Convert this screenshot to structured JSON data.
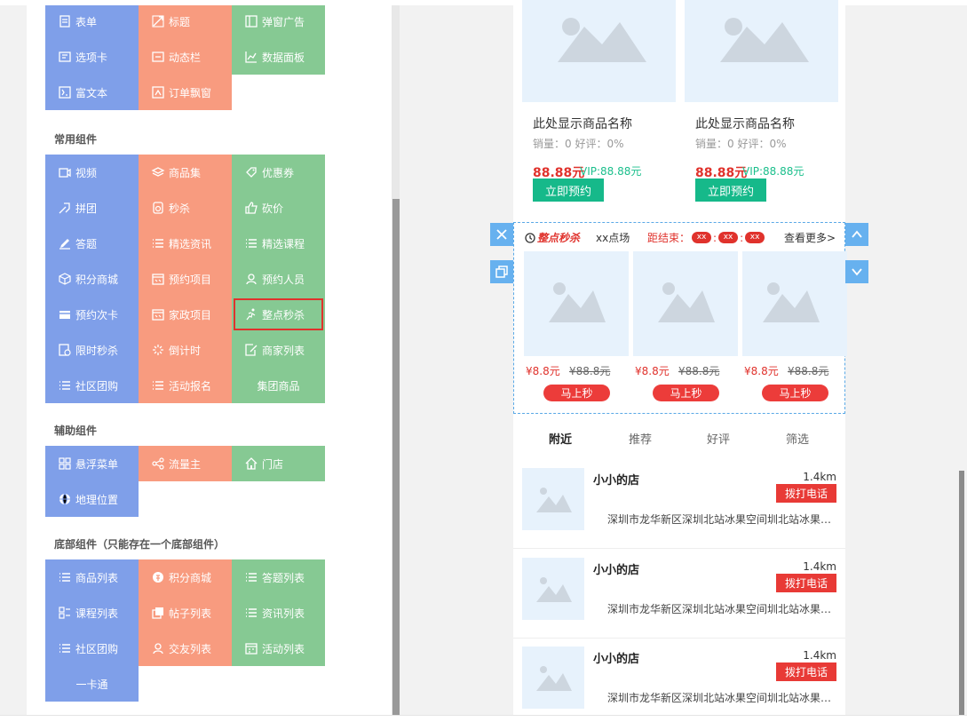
{
  "component_panel": {
    "top_rows": [
      [
        {
          "label": "表单",
          "icon": "form-icon"
        },
        {
          "label": "标题",
          "icon": "title-icon"
        },
        {
          "label": "弹窗广告",
          "icon": "popup-ad-icon"
        }
      ],
      [
        {
          "label": "选项卡",
          "icon": "tab-icon"
        },
        {
          "label": "动态栏",
          "icon": "dynamic-bar-icon"
        },
        {
          "label": "数据面板",
          "icon": "chart-icon"
        }
      ],
      [
        {
          "label": "富文本",
          "icon": "richtext-icon"
        },
        {
          "label": "订单飘窗",
          "icon": "order-float-icon"
        }
      ]
    ],
    "sections": {
      "common": {
        "title": "常用组件",
        "rows": [
          [
            {
              "label": "视频",
              "icon": "video-icon"
            },
            {
              "label": "商品集",
              "icon": "layers-icon"
            },
            {
              "label": "优惠券",
              "icon": "coupon-icon"
            }
          ],
          [
            {
              "label": "拼团",
              "icon": "group-buy-icon"
            },
            {
              "label": "秒杀",
              "icon": "seckill-icon"
            },
            {
              "label": "砍价",
              "icon": "thumb-icon"
            }
          ],
          [
            {
              "label": "答题",
              "icon": "pencil-icon"
            },
            {
              "label": "精选资讯",
              "icon": "list-icon"
            },
            {
              "label": "精选课程",
              "icon": "list-icon"
            }
          ],
          [
            {
              "label": "积分商城",
              "icon": "cube-icon"
            },
            {
              "label": "预约项目",
              "icon": "appointment-icon"
            },
            {
              "label": "预约人员",
              "icon": "person-icon"
            }
          ],
          [
            {
              "label": "预约次卡",
              "icon": "card-icon"
            },
            {
              "label": "家政项目",
              "icon": "appointment-icon"
            },
            {
              "label": "整点秒杀",
              "icon": "running-icon"
            }
          ],
          [
            {
              "label": "限时秒杀",
              "icon": "timer-doc-icon"
            },
            {
              "label": "倒计时",
              "icon": "spinner-icon"
            },
            {
              "label": "商家列表",
              "icon": "edit-doc-icon"
            }
          ],
          [
            {
              "label": "社区团购",
              "icon": "list-icon"
            },
            {
              "label": "活动报名",
              "icon": "list-icon"
            },
            {
              "label": "集团商品",
              "icon": ""
            }
          ]
        ]
      },
      "aux": {
        "title": "辅助组件",
        "rows": [
          [
            {
              "label": "悬浮菜单",
              "icon": "grid-icon"
            },
            {
              "label": "流量主",
              "icon": "share-icon"
            },
            {
              "label": "门店",
              "icon": "home-icon"
            }
          ],
          [
            {
              "label": "地理位置",
              "icon": "globe-icon"
            }
          ]
        ]
      },
      "bottom": {
        "title": "底部组件（只能存在一个底部组件）",
        "rows": [
          [
            {
              "label": "商品列表",
              "icon": "list-icon"
            },
            {
              "label": "积分商城",
              "icon": "coin-icon"
            },
            {
              "label": "答题列表",
              "icon": "list-icon"
            }
          ],
          [
            {
              "label": "课程列表",
              "icon": "course-icon"
            },
            {
              "label": "帖子列表",
              "icon": "post-icon"
            },
            {
              "label": "资讯列表",
              "icon": "list-icon"
            }
          ],
          [
            {
              "label": "社区团购",
              "icon": "list-icon"
            },
            {
              "label": "交友列表",
              "icon": "person-icon"
            },
            {
              "label": "活动列表",
              "icon": "calendar-icon"
            }
          ],
          [
            {
              "label": "一卡通",
              "icon": ""
            }
          ]
        ]
      }
    },
    "selected": "整点秒杀"
  },
  "preview": {
    "products": [
      {
        "name": "此处显示商品名称",
        "meta": "销量：0 好评：0%",
        "price": "88.88元",
        "vip": "VIP:88.88元",
        "button": "立即预约"
      },
      {
        "name": "此处显示商品名称",
        "meta": "销量：0 好评：0%",
        "price": "88.88元",
        "vip": "VIP:88.88元",
        "button": "立即预约"
      }
    ],
    "seckill": {
      "title": "整点秒杀",
      "session": "xx点场",
      "countdown_label": "距结束：",
      "pills": [
        "xx",
        "xx",
        "xx"
      ],
      "more": "查看更多>",
      "items": [
        {
          "price": "¥8.8元",
          "original": "¥88.8元",
          "button": "马上秒"
        },
        {
          "price": "¥8.8元",
          "original": "¥88.8元",
          "button": "马上秒"
        },
        {
          "price": "¥8.8元",
          "original": "¥88.8元",
          "button": "马上秒"
        }
      ]
    },
    "tabs": [
      "附近",
      "推荐",
      "好评",
      "筛选"
    ],
    "stores": [
      {
        "name": "小小的店",
        "distance": "1.4km",
        "button": "拨打电话",
        "address": "深圳市龙华新区深圳北站冰果空间圳北站冰果空间"
      },
      {
        "name": "小小的店",
        "distance": "1.4km",
        "button": "拨打电话",
        "address": "深圳市龙华新区深圳北站冰果空间圳北站冰果空间"
      },
      {
        "name": "小小的店",
        "distance": "1.4km",
        "button": "拨打电话",
        "address": "深圳市龙华新区深圳北站冰果空间圳北站冰果空间"
      }
    ]
  },
  "colors": {
    "blue_tile": "#7f9fe9",
    "orange_tile": "#f89b7f",
    "green_tile": "#86c993",
    "red": "#e0322c",
    "teal_button": "#16b98a",
    "placeholder": "#e7f2fc",
    "selection_border": "#5aa9e6"
  }
}
